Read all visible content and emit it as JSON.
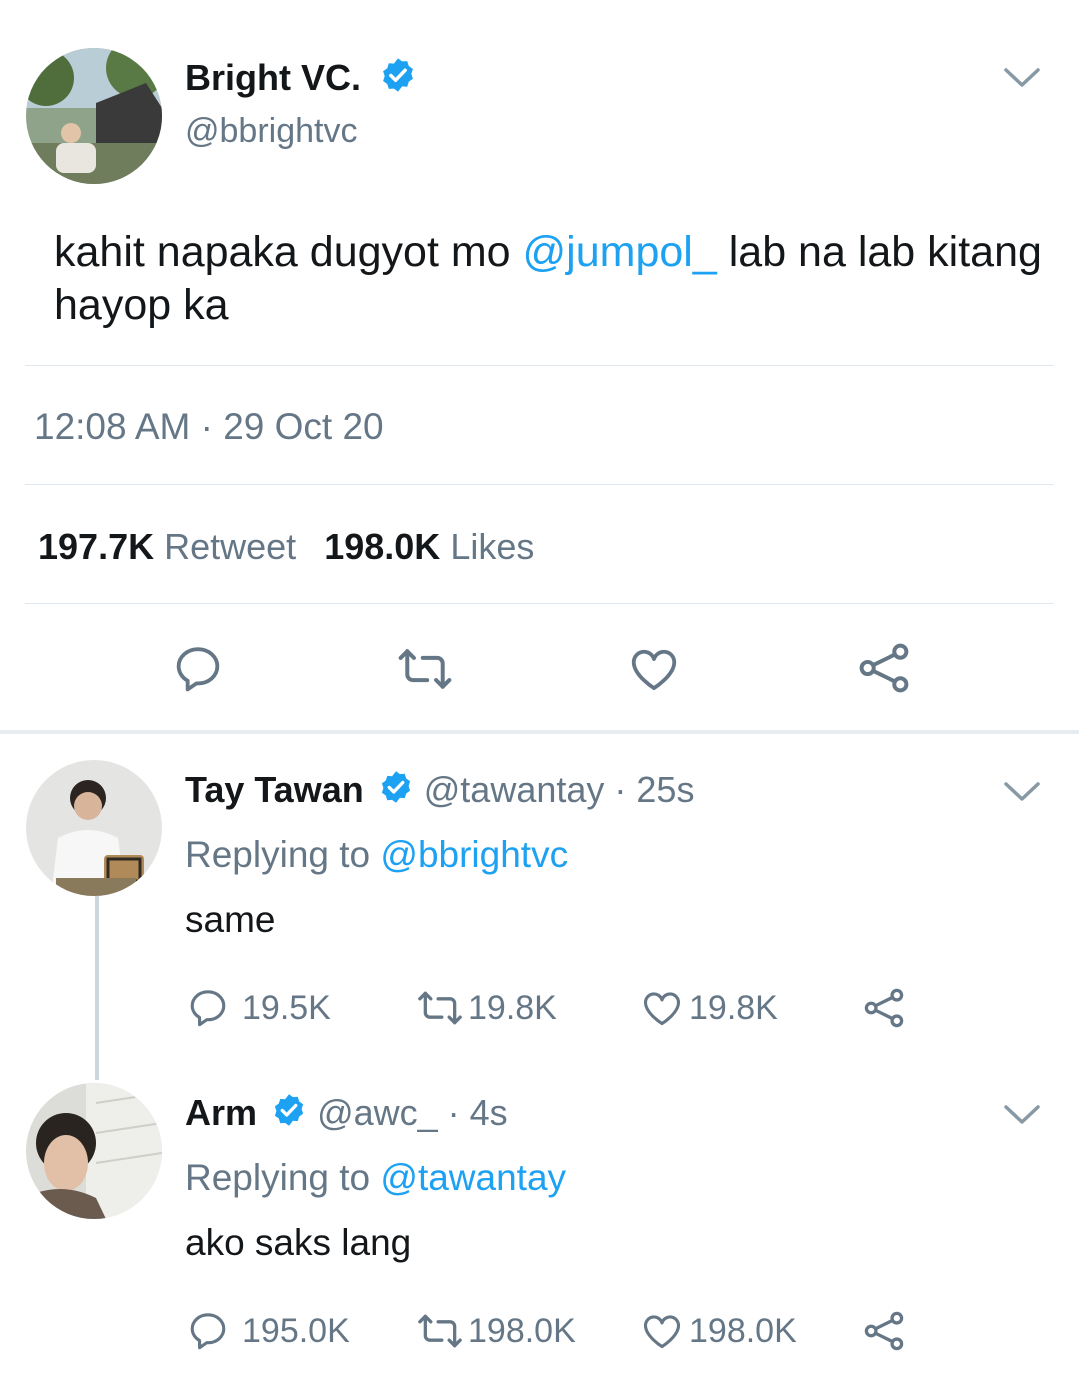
{
  "colors": {
    "accent": "#1da1f2",
    "text": "#14171a",
    "muted": "#657786",
    "divider": "#e1e8ed"
  },
  "main_tweet": {
    "avatar_icon": "profile-photo",
    "name": "Bright VC.",
    "handle": "@bbrightvc",
    "text_before": "kahit napaka dugyot mo ",
    "mention": "@jumpol_",
    "text_after": " lab na lab kitang hayop ka",
    "timestamp": "12:08 AM · 29 Oct 20",
    "retweets_count": "197.7K",
    "retweets_label": "Retweet",
    "likes_count": "198.0K",
    "likes_label": "Likes"
  },
  "replies": [
    {
      "name": "Tay Tawan",
      "handle": "@tawantay",
      "time": "· 25s",
      "replying_label": "Replying to",
      "replying_to": "@bbrightvc",
      "text": "same",
      "replies": "19.5K",
      "retweets": "19.8K",
      "likes": "19.8K"
    },
    {
      "name": "Arm",
      "handle": "@awc_",
      "time": "· 4s",
      "replying_label": "Replying to",
      "replying_to": "@tawantay",
      "text": "ako saks lang",
      "replies": "195.0K",
      "retweets": "198.0K",
      "likes": "198.0K"
    }
  ]
}
